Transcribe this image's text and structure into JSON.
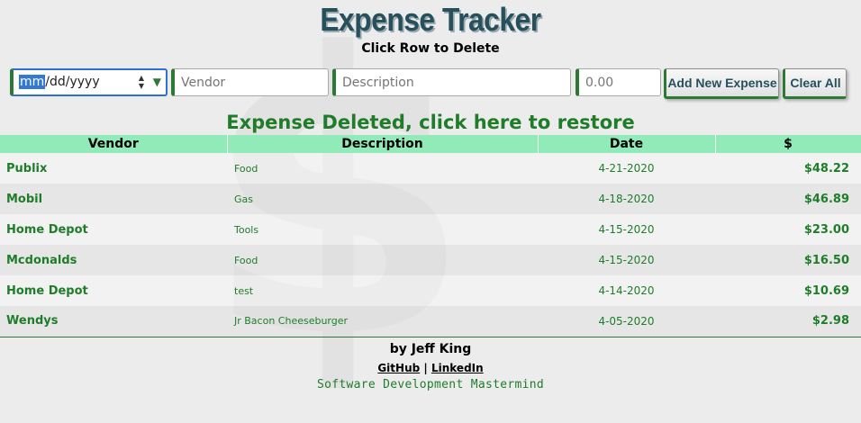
{
  "app": {
    "title": "Expense Tracker",
    "subtitle": "Click Row to Delete",
    "watermark_glyph": "$"
  },
  "form": {
    "date": {
      "mm": "mm",
      "rest": "/dd/yyyy"
    },
    "vendor_placeholder": "Vendor",
    "description_placeholder": "Description",
    "amount_placeholder": "0.00",
    "add_label": "Add New Expense",
    "clear_label": "Clear All"
  },
  "notice": "Expense Deleted, click here to restore",
  "table": {
    "headers": [
      "Vendor",
      "Description",
      "Date",
      "$"
    ],
    "rows": [
      {
        "vendor": "Publix",
        "description": "Food",
        "date": "4-21-2020",
        "amount": "$48.22"
      },
      {
        "vendor": "Mobil",
        "description": "Gas",
        "date": "4-18-2020",
        "amount": "$46.89"
      },
      {
        "vendor": "Home Depot",
        "description": "Tools",
        "date": "4-15-2020",
        "amount": "$23.00"
      },
      {
        "vendor": "Mcdonalds",
        "description": "Food",
        "date": "4-15-2020",
        "amount": "$16.50"
      },
      {
        "vendor": "Home Depot",
        "description": "test",
        "date": "4-14-2020",
        "amount": "$10.69"
      },
      {
        "vendor": "Wendys",
        "description": "Jr Bacon Cheeseburger",
        "date": "4-05-2020",
        "amount": "$2.98"
      }
    ]
  },
  "footer": {
    "byline": "by Jeff King",
    "github": "GitHub",
    "separator": "|",
    "linkedin": "LinkedIn",
    "tagline": "Software Development Mastermind"
  },
  "colors": {
    "title": "#25505c",
    "accent_green": "#1f7d2a",
    "header_row": "#90ebb9",
    "background": "#ececec"
  },
  "icons": {
    "date_spinner": "spinner-arrows-icon",
    "date_dropdown": "dropdown-triangle-icon"
  }
}
